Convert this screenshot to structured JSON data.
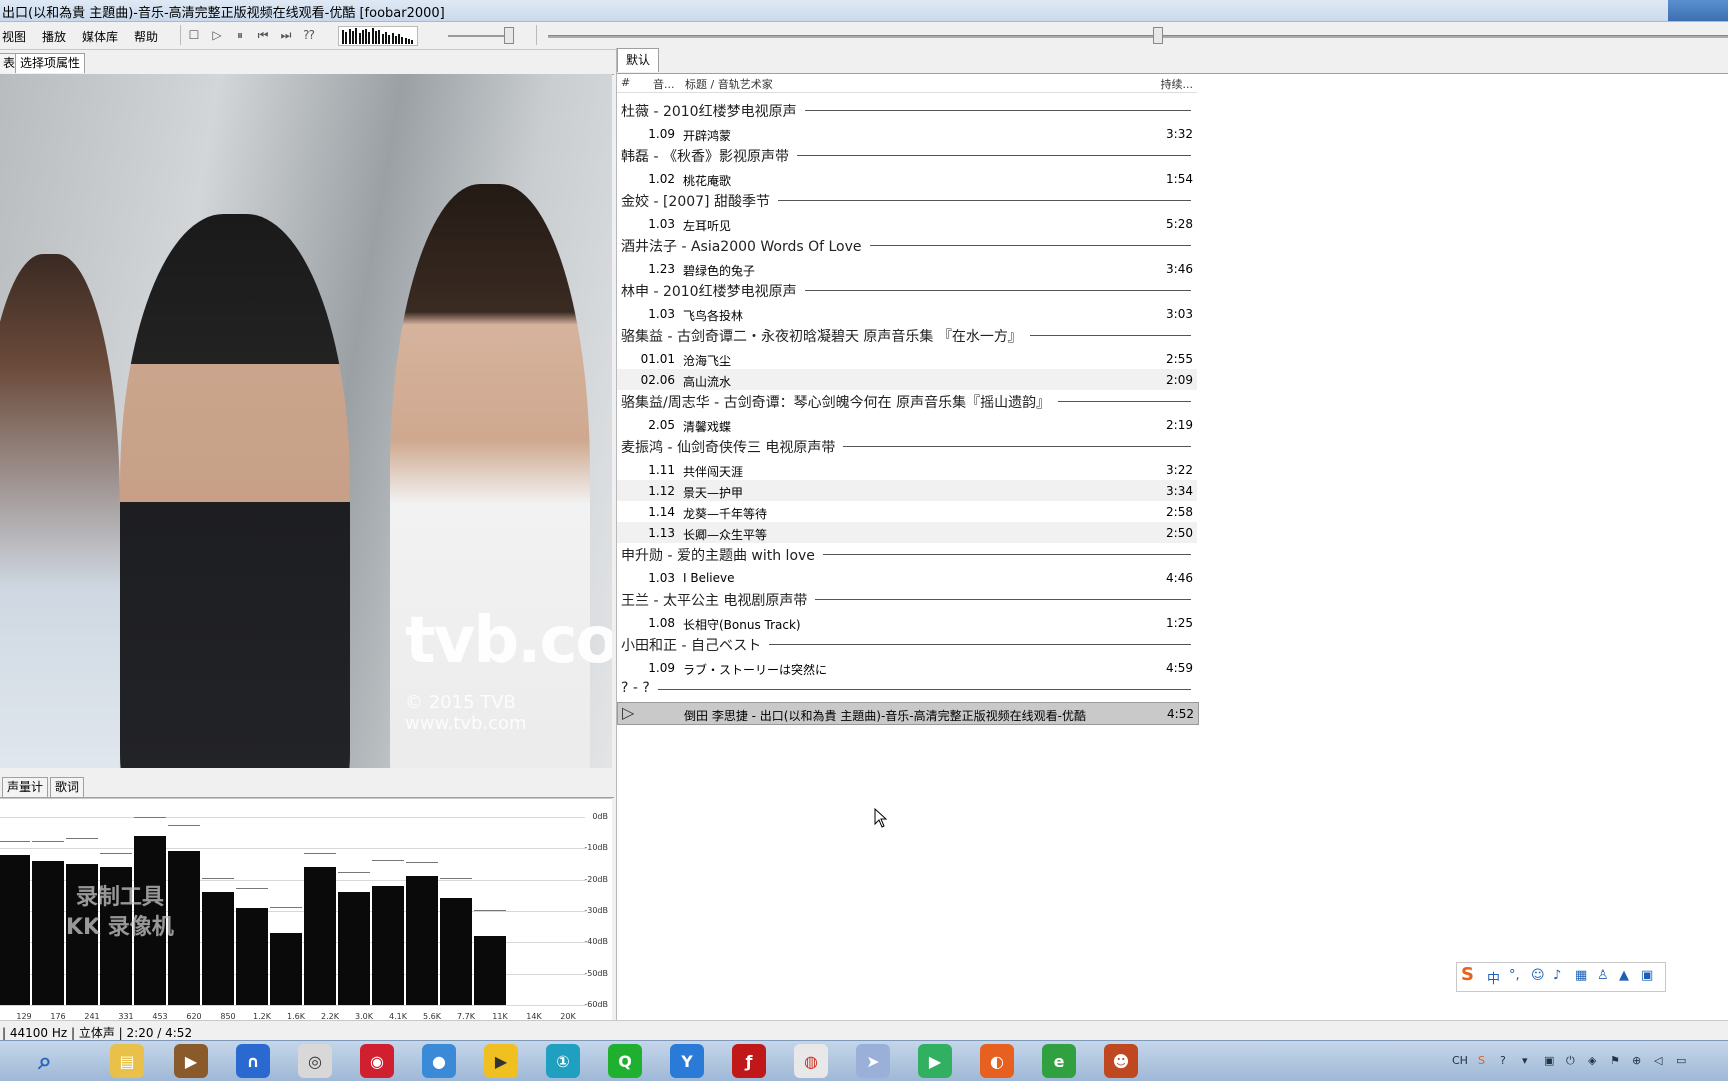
{
  "window": {
    "title": "出口(以和為貴 主題曲)-音乐-高清完整正版视频在线观看-优酷  [foobar2000]"
  },
  "menu": [
    "视图",
    "播放",
    "媒体库",
    "帮助"
  ],
  "left_tabs": {
    "tab1": "表",
    "tab2": "选择项属性"
  },
  "bottom_tabs": {
    "tab1": "声量计",
    "tab2": "歌词"
  },
  "video": {
    "logo": "tvb.com",
    "copyright": "© 2015 TVB  www.tvb.com"
  },
  "spectrum": {
    "db_labels": [
      "0dB",
      "-10dB",
      "-20dB",
      "-30dB",
      "-40dB",
      "-50dB",
      "-60dB"
    ],
    "freq_labels": [
      "129",
      "176",
      "241",
      "331",
      "453",
      "620",
      "850",
      "1.2K",
      "1.6K",
      "2.2K",
      "3.0K",
      "4.1K",
      "5.6K",
      "7.7K",
      "11K",
      "14K",
      "20K"
    ],
    "levels_db": [
      -12,
      -14,
      -15,
      -16,
      -6,
      -11,
      -24,
      -29,
      -37,
      -16,
      -24,
      -22,
      -19,
      -26,
      -38
    ],
    "watermark_line1": "录制工具",
    "watermark_line2": "KK 录像机"
  },
  "playlist": {
    "tab": "默认",
    "headers": {
      "col1": "#",
      "col2": "音...",
      "col3": "标题 / 音轨艺术家",
      "col4": "持续..."
    },
    "groups": [
      {
        "title": "杜薇 - 2010红楼梦电视原声",
        "tracks": [
          {
            "num": "1.09",
            "title": "开辟鸿蒙",
            "duration": "3:32"
          }
        ]
      },
      {
        "title": "韩磊 - 《秋香》影视原声带",
        "tracks": [
          {
            "num": "1.02",
            "title": "桃花庵歌",
            "duration": "1:54"
          }
        ]
      },
      {
        "title": "金姣 - [2007] 甜酸季节",
        "tracks": [
          {
            "num": "1.03",
            "title": "左耳听见",
            "duration": "5:28"
          }
        ]
      },
      {
        "title": "酒井法子 - Asia2000 Words Of Love",
        "tracks": [
          {
            "num": "1.23",
            "title": "碧绿色的兔子",
            "duration": "3:46"
          }
        ]
      },
      {
        "title": "林申 - 2010红楼梦电视原声",
        "tracks": [
          {
            "num": "1.03",
            "title": "飞鸟各投林",
            "duration": "3:03"
          }
        ]
      },
      {
        "title": "骆集益 - 古剑奇谭二・永夜初晗凝碧天 原声音乐集 『在水一方』",
        "tracks": [
          {
            "num": "01.01",
            "title": "沧海飞尘",
            "duration": "2:55"
          },
          {
            "num": "02.06",
            "title": "高山流水",
            "duration": "2:09"
          }
        ]
      },
      {
        "title": "骆集益/周志华 - 古剑奇谭：琴心剑魄今何在 原声音乐集『摇山遗韵』",
        "tracks": [
          {
            "num": "2.05",
            "title": "清馨戏蝶",
            "duration": "2:19"
          }
        ]
      },
      {
        "title": "麦振鸿 - 仙剑奇侠传三 电视原声带",
        "tracks": [
          {
            "num": "1.11",
            "title": "共伴闯天涯",
            "duration": "3:22"
          },
          {
            "num": "1.12",
            "title": "景天—护甲",
            "duration": "3:34"
          },
          {
            "num": "1.14",
            "title": "龙葵—千年等待",
            "duration": "2:58"
          },
          {
            "num": "1.13",
            "title": "长卿—众生平等",
            "duration": "2:50"
          }
        ]
      },
      {
        "title": "申升勋 - 爱的主题曲 with love",
        "tracks": [
          {
            "num": "1.03",
            "title": "I Believe",
            "duration": "4:46"
          }
        ]
      },
      {
        "title": "王兰 - 太平公主 电视剧原声带",
        "tracks": [
          {
            "num": "1.08",
            "title": "长相守(Bonus Track)",
            "duration": "1:25"
          }
        ]
      },
      {
        "title": "小田和正 - 自己ベスト",
        "tracks": [
          {
            "num": "1.09",
            "title": "ラブ・ストーリーは突然に",
            "duration": "4:59"
          }
        ]
      },
      {
        "title": "? - ?",
        "tracks": [
          {
            "num": "",
            "title": "倒田 李思捷 - 出口(以和為貴 主題曲)-音乐-高清完整正版视频在线观看-优酷",
            "duration": "4:52",
            "playing": true
          }
        ]
      }
    ]
  },
  "status": {
    "text": "| 44100 Hz | 立体声 | 2:20 / 4:52"
  },
  "ime": {
    "label": "中"
  },
  "tray": {
    "lang": "CH"
  }
}
